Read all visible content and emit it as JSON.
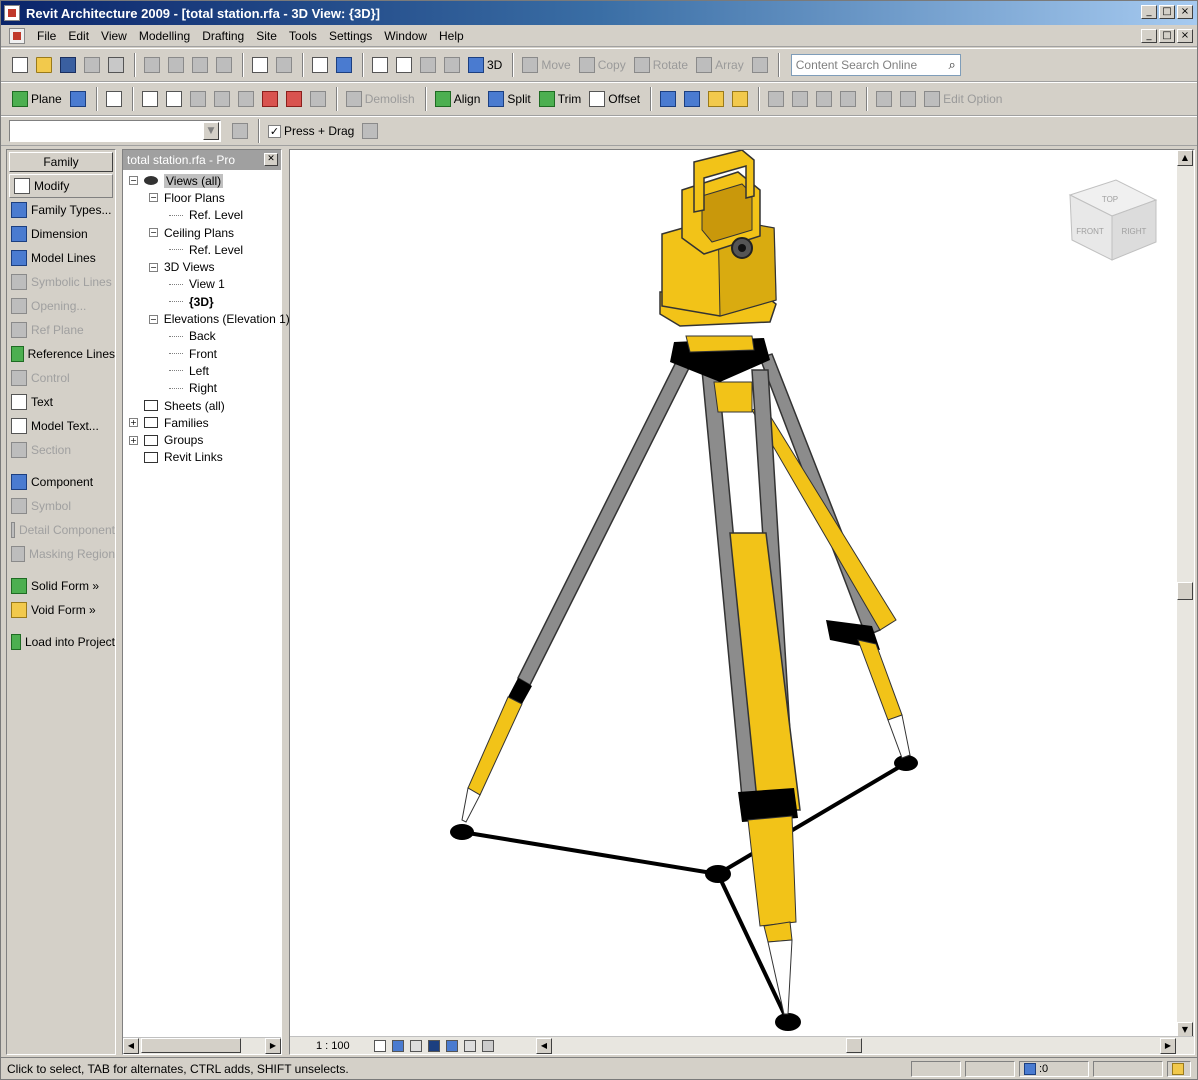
{
  "window": {
    "title": "Revit Architecture 2009 - [total station.rfa - 3D View: {3D}]",
    "controls": [
      "_",
      "□",
      "×"
    ]
  },
  "menubar": {
    "items": [
      {
        "label": "File"
      },
      {
        "label": "Edit"
      },
      {
        "label": "View"
      },
      {
        "label": "Modelling"
      },
      {
        "label": "Drafting"
      },
      {
        "label": "Site"
      },
      {
        "label": "Tools"
      },
      {
        "label": "Settings"
      },
      {
        "label": "Window"
      },
      {
        "label": "Help"
      }
    ]
  },
  "toolbar1": {
    "view3d_label": "3D",
    "move_label": "Move",
    "copy_label": "Copy",
    "rotate_label": "Rotate",
    "array_label": "Array",
    "search_placeholder": "Content Search Online"
  },
  "toolbar2": {
    "plane_label": "Plane",
    "demolish_label": "Demolish",
    "align_label": "Align",
    "split_label": "Split",
    "trim_label": "Trim",
    "offset_label": "Offset",
    "edit_option_label": "Edit Option"
  },
  "toolbar3": {
    "combo_value": "",
    "press_drag_label": "Press + Drag",
    "press_drag_checked": true
  },
  "family_panel": {
    "header": "Family",
    "items": [
      {
        "label": "Modify",
        "icon": "arrow-icon",
        "enabled": true,
        "selected": true
      },
      {
        "label": "Family Types...",
        "icon": "family-types-icon",
        "enabled": true
      },
      {
        "label": "Dimension",
        "icon": "dimension-icon",
        "enabled": true
      },
      {
        "label": "Model Lines",
        "icon": "model-lines-icon",
        "enabled": true
      },
      {
        "label": "Symbolic Lines",
        "icon": "symbolic-lines-icon",
        "enabled": false
      },
      {
        "label": "Opening...",
        "icon": "opening-icon",
        "enabled": false
      },
      {
        "label": "Ref Plane",
        "icon": "ref-plane-icon",
        "enabled": false
      },
      {
        "label": "Reference Lines",
        "icon": "reference-lines-icon",
        "enabled": true
      },
      {
        "label": "Control",
        "icon": "control-icon",
        "enabled": false
      },
      {
        "label": "Text",
        "icon": "text-icon",
        "enabled": true
      },
      {
        "label": "Model Text...",
        "icon": "model-text-icon",
        "enabled": true
      },
      {
        "label": "Section",
        "icon": "section-icon",
        "enabled": false
      },
      {
        "label": "Component",
        "icon": "component-icon",
        "enabled": true
      },
      {
        "label": "Symbol",
        "icon": "symbol-icon",
        "enabled": false
      },
      {
        "label": "Detail Component",
        "icon": "detail-component-icon",
        "enabled": false
      },
      {
        "label": "Masking Region",
        "icon": "masking-region-icon",
        "enabled": false
      },
      {
        "label": "Solid Form »",
        "icon": "solid-form-icon",
        "enabled": true
      },
      {
        "label": "Void Form »",
        "icon": "void-form-icon",
        "enabled": true
      },
      {
        "label": "Load into Project",
        "icon": "load-into-project-icon",
        "enabled": true
      }
    ]
  },
  "browser": {
    "title": "total station.rfa - Pro",
    "tree": [
      {
        "label": "Views (all)",
        "level": 0,
        "toggle": "−",
        "icon": "eye-icon",
        "selected": true
      },
      {
        "label": "Floor Plans",
        "level": 1,
        "toggle": "−"
      },
      {
        "label": "Ref. Level",
        "level": 2
      },
      {
        "label": "Ceiling Plans",
        "level": 1,
        "toggle": "−"
      },
      {
        "label": "Ref. Level",
        "level": 2
      },
      {
        "label": "3D Views",
        "level": 1,
        "toggle": "−"
      },
      {
        "label": "View 1",
        "level": 2
      },
      {
        "label": "{3D}",
        "level": 2,
        "bold": true
      },
      {
        "label": "Elevations (Elevation 1)",
        "level": 1,
        "toggle": "−"
      },
      {
        "label": "Back",
        "level": 2
      },
      {
        "label": "Front",
        "level": 2
      },
      {
        "label": "Left",
        "level": 2
      },
      {
        "label": "Right",
        "level": 2
      },
      {
        "label": "Sheets (all)",
        "level": 0,
        "icon": "sheet-icon"
      },
      {
        "label": "Families",
        "level": 0,
        "toggle": "+",
        "icon": "families-icon"
      },
      {
        "label": "Groups",
        "level": 0,
        "toggle": "+",
        "icon": "groups-icon"
      },
      {
        "label": "Revit Links",
        "level": 0,
        "icon": "links-icon"
      }
    ]
  },
  "viewport": {
    "scale": "1 : 100",
    "viewcube_top": "TOP",
    "viewcube_front": "FRONT",
    "viewcube_right": "RIGHT"
  },
  "statusbar": {
    "text": "Click to select, TAB for alternates, CTRL adds, SHIFT unselects.",
    "filter_count": ":0"
  },
  "colors": {
    "model_yellow": "#f2c318",
    "model_gray": "#8c8c8c",
    "title_blue": "#0a246a"
  }
}
